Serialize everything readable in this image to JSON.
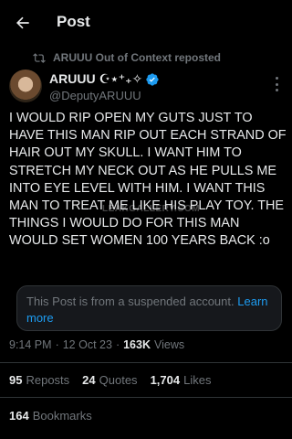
{
  "header": {
    "title": "Post",
    "back_icon": "arrow-left-icon"
  },
  "repost": {
    "icon": "repost-icon",
    "text": "ARUUU Out of Context reposted"
  },
  "author": {
    "name": "ARUUU ☪︎⋆⁺₊✧",
    "handle": "@DeputyARUUU",
    "verified": true,
    "verified_color": "#1d9bf0"
  },
  "post": {
    "text": "I WOULD RIP OPEN MY GUTS JUST TO HAVE THIS MAN RIP OUT EACH STRAND OF HAIR OUT MY SKULL. I WANT HIM TO STRETCH MY NECK OUT AS HE PULLS ME INTO EYE LEVEL WITH HIM. I WANT THIS MAN TO TREAT ME LIKE HIS PLAY TOY. THE THINGS I WOULD DO FOR THIS MAN WOULD SET WOMEN 100 YEARS BACK :o",
    "watermark": "LEAKGALLERY.COM"
  },
  "notice": {
    "text": "This Post is from a suspended account.",
    "link": "Learn more"
  },
  "meta": {
    "time": "9:14 PM",
    "separator": "·",
    "date": "12 Oct 23",
    "views_count": "163K",
    "views_label": "Views"
  },
  "stats": {
    "reposts_count": "95",
    "reposts_label": "Reposts",
    "quotes_count": "24",
    "quotes_label": "Quotes",
    "likes_count": "1,704",
    "likes_label": "Likes",
    "bookmarks_count": "164",
    "bookmarks_label": "Bookmarks"
  },
  "colors": {
    "background": "#000000",
    "text": "#e7e9ea",
    "muted": "#71767b",
    "accent": "#1d9bf0",
    "divider": "#2f3336"
  }
}
